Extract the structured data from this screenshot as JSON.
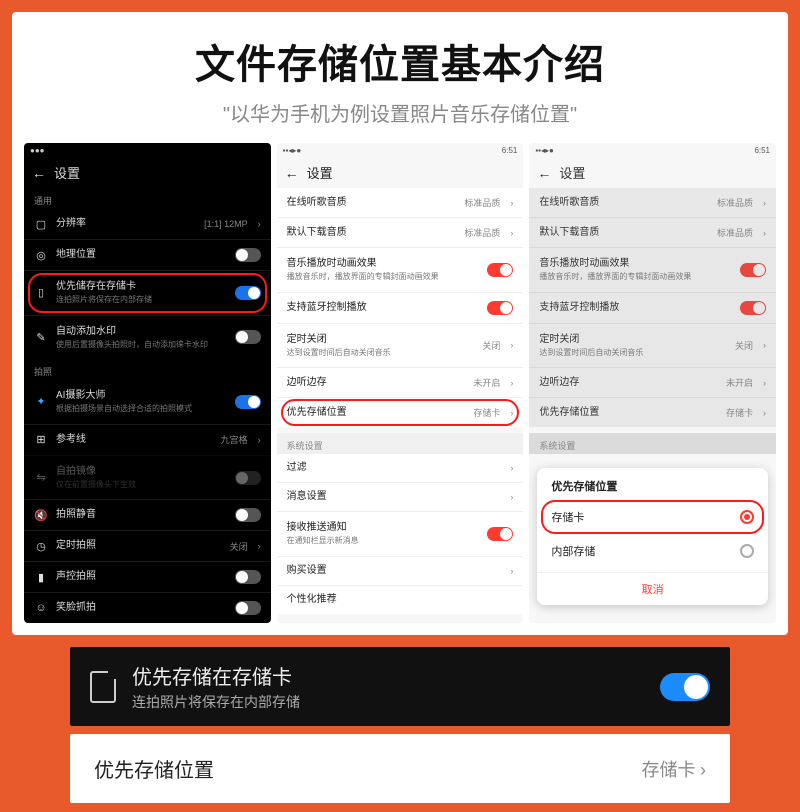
{
  "header": {
    "title": "文件存储位置基本介绍",
    "subtitle": "\"以华为手机为例设置照片音乐存储位置\""
  },
  "status_time": "6:51",
  "dark_phone": {
    "title": "设置",
    "section1": "通用",
    "resolution": {
      "label": "分辨率",
      "value": "[1:1] 12MP"
    },
    "geo": "地理位置",
    "store_sd": {
      "title": "优先储存在存储卡",
      "sub": "连拍照片将保存在内部存储"
    },
    "watermark": {
      "title": "自动添加水印",
      "sub": "使用后置摄像头拍照时，自动添加徕卡水印"
    },
    "section2": "拍照",
    "ai": {
      "title": "AI摄影大师",
      "sub": "根据拍摄场景自动选择合适的拍照模式"
    },
    "reference": {
      "label": "参考线",
      "value": "九宫格"
    },
    "mirror": {
      "title": "自拍镜像",
      "sub": "仅在前置摄像头下生效"
    },
    "mute": "拍照静音",
    "timer": {
      "label": "定时拍照",
      "value": "关闭"
    },
    "voice": "声控拍照",
    "smile": "笑脸抓拍"
  },
  "light_phone": {
    "title": "设置",
    "online_q": {
      "label": "在线听歌音质",
      "value": "标准品质"
    },
    "download_q": {
      "label": "默认下载音质",
      "value": "标准品质"
    },
    "anim": {
      "title": "音乐播放时动画效果",
      "sub": "播放音乐时，播放界面的专辑封面动画效果"
    },
    "bt": "支持蓝牙控制播放",
    "timer_off": {
      "title": "定时关闭",
      "sub": "达到设置时间后自动关闭音乐",
      "value": "关闭"
    },
    "cache": {
      "label": "边听边存",
      "value": "未开启"
    },
    "storage": {
      "label": "优先存储位置",
      "value": "存储卡"
    },
    "section_sys": "系统设置",
    "filter": "过滤",
    "msg": "消息设置",
    "push": {
      "title": "接收推送通知",
      "sub": "在通知栏显示新消息"
    },
    "buy": "购买设置",
    "personal": "个性化推荐"
  },
  "dialog": {
    "title": "优先存储位置",
    "opt_sd": "存储卡",
    "opt_internal": "内部存储",
    "cancel": "取消"
  },
  "strip_dark": {
    "title": "优先存储在存储卡",
    "sub": "连拍照片将保存在内部存储"
  },
  "strip_light": {
    "label": "优先存储位置",
    "value": "存储卡"
  }
}
